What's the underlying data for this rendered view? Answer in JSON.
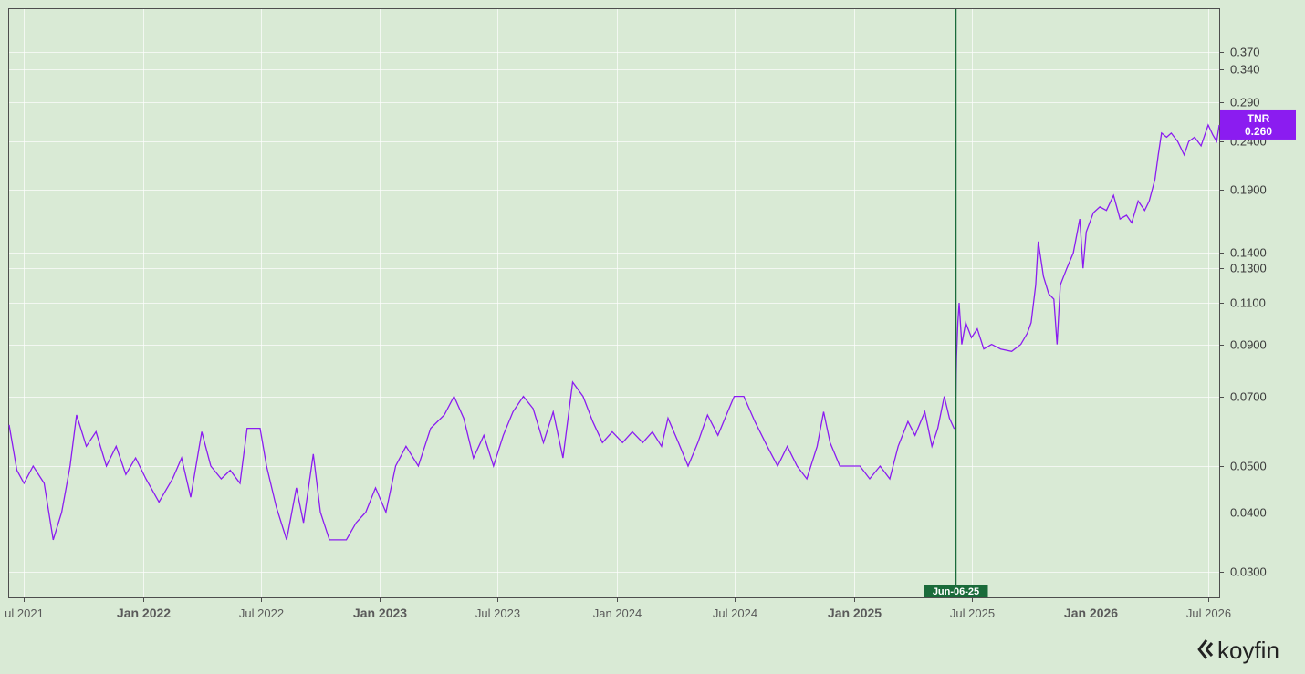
{
  "chart_data": {
    "type": "line",
    "title": "",
    "xlabel": "",
    "ylabel": "",
    "y_scale": "log",
    "ylim": [
      0.0265,
      0.455
    ],
    "xlim": [
      "2021-06-08",
      "2026-07-18"
    ],
    "grid": true,
    "y_ticks": [
      0.37,
      0.34,
      0.29,
      0.24,
      0.19,
      0.14,
      0.13,
      0.11,
      0.09,
      0.07,
      0.05,
      0.04,
      0.03
    ],
    "y_tick_labels": [
      "0.370",
      "0.340",
      "0.290",
      "0.2400",
      "0.1900",
      "0.1400",
      "0.1300",
      "0.1100",
      "0.0900",
      "0.0700",
      "0.0500",
      "0.0400",
      "0.0300"
    ],
    "x_ticks": [
      {
        "date": "2021-07-01",
        "label": "ul 2021",
        "major": false
      },
      {
        "date": "2022-01-01",
        "label": "Jan 2022",
        "major": true
      },
      {
        "date": "2022-07-01",
        "label": "Jul 2022",
        "major": false
      },
      {
        "date": "2023-01-01",
        "label": "Jan 2023",
        "major": true
      },
      {
        "date": "2023-07-01",
        "label": "Jul 2023",
        "major": false
      },
      {
        "date": "2024-01-01",
        "label": "Jan 2024",
        "major": false
      },
      {
        "date": "2024-07-01",
        "label": "Jul 2024",
        "major": false
      },
      {
        "date": "2025-01-01",
        "label": "Jan 2025",
        "major": true
      },
      {
        "date": "2025-07-01",
        "label": "Jul 2025",
        "major": false
      },
      {
        "date": "2026-01-01",
        "label": "Jan 2026",
        "major": true
      },
      {
        "date": "2026-07-01",
        "label": "Jul 2026",
        "major": false
      }
    ],
    "series": [
      {
        "name": "TNR",
        "color": "#8b1cf0",
        "last_value_label": "0.260",
        "points": [
          [
            "2021-06-08",
            0.061
          ],
          [
            "2021-06-20",
            0.049
          ],
          [
            "2021-07-01",
            0.046
          ],
          [
            "2021-07-15",
            0.05
          ],
          [
            "2021-08-01",
            0.046
          ],
          [
            "2021-08-15",
            0.035
          ],
          [
            "2021-08-28",
            0.04
          ],
          [
            "2021-09-10",
            0.05
          ],
          [
            "2021-09-20",
            0.064
          ],
          [
            "2021-10-05",
            0.055
          ],
          [
            "2021-10-20",
            0.059
          ],
          [
            "2021-11-05",
            0.05
          ],
          [
            "2021-11-20",
            0.055
          ],
          [
            "2021-12-05",
            0.048
          ],
          [
            "2021-12-20",
            0.052
          ],
          [
            "2022-01-05",
            0.047
          ],
          [
            "2022-01-25",
            0.042
          ],
          [
            "2022-02-15",
            0.047
          ],
          [
            "2022-03-01",
            0.052
          ],
          [
            "2022-03-15",
            0.043
          ],
          [
            "2022-04-01",
            0.059
          ],
          [
            "2022-04-15",
            0.05
          ],
          [
            "2022-05-01",
            0.047
          ],
          [
            "2022-05-15",
            0.049
          ],
          [
            "2022-05-30",
            0.046
          ],
          [
            "2022-06-10",
            0.06
          ],
          [
            "2022-06-30",
            0.06
          ],
          [
            "2022-07-10",
            0.05
          ],
          [
            "2022-07-25",
            0.041
          ],
          [
            "2022-08-10",
            0.035
          ],
          [
            "2022-08-25",
            0.045
          ],
          [
            "2022-09-05",
            0.038
          ],
          [
            "2022-09-20",
            0.053
          ],
          [
            "2022-10-01",
            0.04
          ],
          [
            "2022-10-15",
            0.035
          ],
          [
            "2022-11-10",
            0.035
          ],
          [
            "2022-11-25",
            0.038
          ],
          [
            "2022-12-10",
            0.04
          ],
          [
            "2022-12-25",
            0.045
          ],
          [
            "2023-01-10",
            0.04
          ],
          [
            "2023-01-25",
            0.05
          ],
          [
            "2023-02-10",
            0.055
          ],
          [
            "2023-03-01",
            0.05
          ],
          [
            "2023-03-20",
            0.06
          ],
          [
            "2023-04-10",
            0.064
          ],
          [
            "2023-04-25",
            0.07
          ],
          [
            "2023-05-10",
            0.063
          ],
          [
            "2023-05-25",
            0.052
          ],
          [
            "2023-06-10",
            0.058
          ],
          [
            "2023-06-25",
            0.05
          ],
          [
            "2023-07-10",
            0.058
          ],
          [
            "2023-07-25",
            0.065
          ],
          [
            "2023-08-10",
            0.07
          ],
          [
            "2023-08-25",
            0.066
          ],
          [
            "2023-09-10",
            0.056
          ],
          [
            "2023-09-25",
            0.065
          ],
          [
            "2023-10-10",
            0.052
          ],
          [
            "2023-10-25",
            0.075
          ],
          [
            "2023-11-10",
            0.07
          ],
          [
            "2023-11-25",
            0.062
          ],
          [
            "2023-12-10",
            0.056
          ],
          [
            "2023-12-25",
            0.059
          ],
          [
            "2024-01-10",
            0.056
          ],
          [
            "2024-01-25",
            0.059
          ],
          [
            "2024-02-10",
            0.056
          ],
          [
            "2024-02-25",
            0.059
          ],
          [
            "2024-03-10",
            0.055
          ],
          [
            "2024-03-20",
            0.063
          ],
          [
            "2024-04-05",
            0.056
          ],
          [
            "2024-04-20",
            0.05
          ],
          [
            "2024-05-05",
            0.056
          ],
          [
            "2024-05-20",
            0.064
          ],
          [
            "2024-06-05",
            0.058
          ],
          [
            "2024-06-20",
            0.065
          ],
          [
            "2024-06-30",
            0.07
          ],
          [
            "2024-07-15",
            0.07
          ],
          [
            "2024-08-01",
            0.062
          ],
          [
            "2024-08-20",
            0.055
          ],
          [
            "2024-09-05",
            0.05
          ],
          [
            "2024-09-20",
            0.055
          ],
          [
            "2024-10-05",
            0.05
          ],
          [
            "2024-10-20",
            0.047
          ],
          [
            "2024-11-05",
            0.055
          ],
          [
            "2024-11-15",
            0.065
          ],
          [
            "2024-11-25",
            0.056
          ],
          [
            "2024-12-10",
            0.05
          ],
          [
            "2024-12-25",
            0.05
          ],
          [
            "2025-01-10",
            0.05
          ],
          [
            "2025-01-25",
            0.047
          ],
          [
            "2025-02-10",
            0.05
          ],
          [
            "2025-02-25",
            0.047
          ],
          [
            "2025-03-10",
            0.055
          ],
          [
            "2025-03-25",
            0.062
          ],
          [
            "2025-04-05",
            0.058
          ],
          [
            "2025-04-20",
            0.065
          ],
          [
            "2025-05-01",
            0.055
          ],
          [
            "2025-05-10",
            0.06
          ],
          [
            "2025-05-20",
            0.07
          ],
          [
            "2025-05-28",
            0.063
          ],
          [
            "2025-06-04",
            0.06
          ],
          [
            "2025-06-06",
            0.06
          ],
          [
            "2025-06-08",
            0.085
          ],
          [
            "2025-06-10",
            0.1
          ],
          [
            "2025-06-12",
            0.11
          ],
          [
            "2025-06-16",
            0.09
          ],
          [
            "2025-06-22",
            0.1
          ],
          [
            "2025-07-01",
            0.093
          ],
          [
            "2025-07-10",
            0.097
          ],
          [
            "2025-07-20",
            0.088
          ],
          [
            "2025-08-01",
            0.09
          ],
          [
            "2025-08-15",
            0.088
          ],
          [
            "2025-09-01",
            0.087
          ],
          [
            "2025-09-15",
            0.09
          ],
          [
            "2025-09-25",
            0.095
          ],
          [
            "2025-10-01",
            0.1
          ],
          [
            "2025-10-08",
            0.12
          ],
          [
            "2025-10-12",
            0.148
          ],
          [
            "2025-10-20",
            0.125
          ],
          [
            "2025-10-28",
            0.115
          ],
          [
            "2025-11-05",
            0.112
          ],
          [
            "2025-11-10",
            0.09
          ],
          [
            "2025-11-15",
            0.12
          ],
          [
            "2025-11-25",
            0.13
          ],
          [
            "2025-12-05",
            0.14
          ],
          [
            "2025-12-15",
            0.165
          ],
          [
            "2025-12-20",
            0.13
          ],
          [
            "2025-12-25",
            0.155
          ],
          [
            "2026-01-05",
            0.17
          ],
          [
            "2026-01-15",
            0.175
          ],
          [
            "2026-01-25",
            0.172
          ],
          [
            "2026-02-05",
            0.185
          ],
          [
            "2026-02-15",
            0.165
          ],
          [
            "2026-02-25",
            0.168
          ],
          [
            "2026-03-05",
            0.162
          ],
          [
            "2026-03-15",
            0.18
          ],
          [
            "2026-03-25",
            0.172
          ],
          [
            "2026-04-01",
            0.18
          ],
          [
            "2026-04-10",
            0.2
          ],
          [
            "2026-04-15",
            0.225
          ],
          [
            "2026-04-20",
            0.25
          ],
          [
            "2026-04-28",
            0.245
          ],
          [
            "2026-05-05",
            0.25
          ],
          [
            "2026-05-15",
            0.24
          ],
          [
            "2026-05-25",
            0.225
          ],
          [
            "2026-06-01",
            0.24
          ],
          [
            "2026-06-10",
            0.245
          ],
          [
            "2026-06-20",
            0.235
          ],
          [
            "2026-07-01",
            0.26
          ],
          [
            "2026-07-08",
            0.248
          ],
          [
            "2026-07-14",
            0.24
          ],
          [
            "2026-07-18",
            0.26
          ]
        ]
      }
    ],
    "annotations": [
      {
        "type": "vertical-line",
        "date": "2025-06-06",
        "label": "Jun-06-25",
        "color": "#1a6b3a"
      }
    ]
  },
  "branding": {
    "logo_icon": "koyfin-icon",
    "logo_text": "koyfin"
  },
  "colors": {
    "background": "#d9ead5",
    "series": "#8b1cf0",
    "marker": "#1a6b3a",
    "badge": "#8b1cf0"
  }
}
